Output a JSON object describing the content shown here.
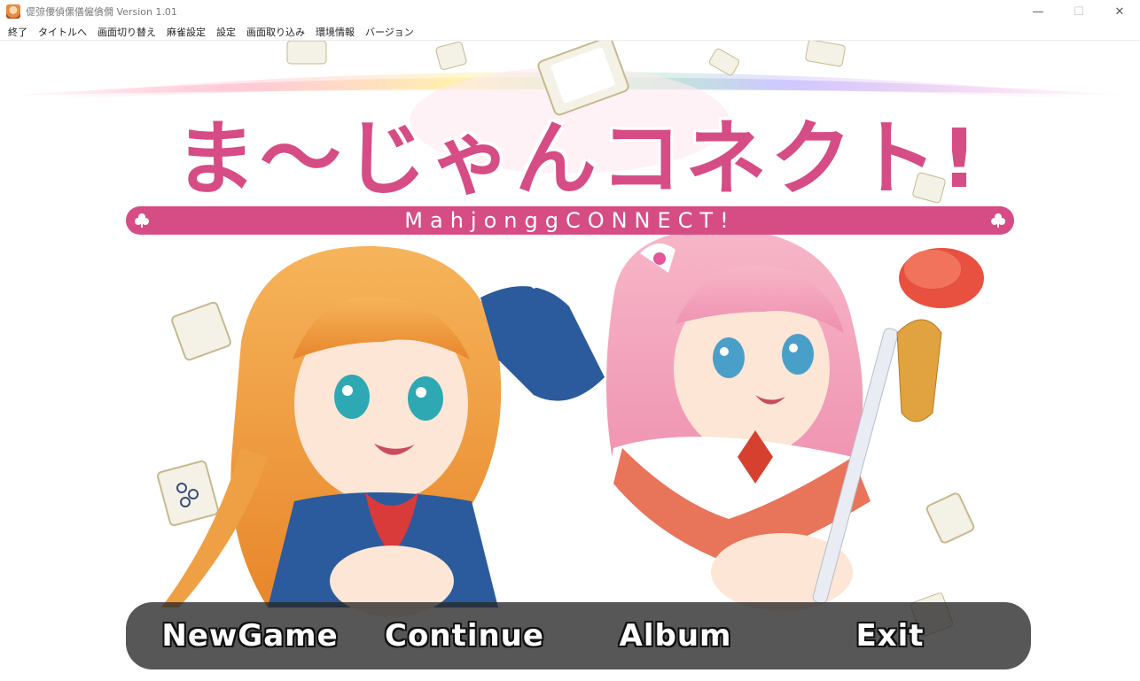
{
  "window": {
    "title": "偍弶偠偵傫僐僱僋僩 Version 1.01",
    "controls": {
      "minimize": "—",
      "maximize": "☐",
      "close": "✕"
    }
  },
  "menu": [
    "終了",
    "タイトルへ",
    "画面切り替え",
    "麻雀設定",
    "設定",
    "画面取り込み",
    "環境情報",
    "バージョン"
  ],
  "logo": {
    "japanese": "ま〜じゃんコネクト!",
    "english": "MahjonggCONNECT!"
  },
  "title_menu": {
    "new_game": "NewGame",
    "continue": "Continue",
    "album": "Album",
    "exit": "Exit"
  },
  "colors": {
    "logo_pink": "#d64c84",
    "menu_bg": "#282828"
  }
}
